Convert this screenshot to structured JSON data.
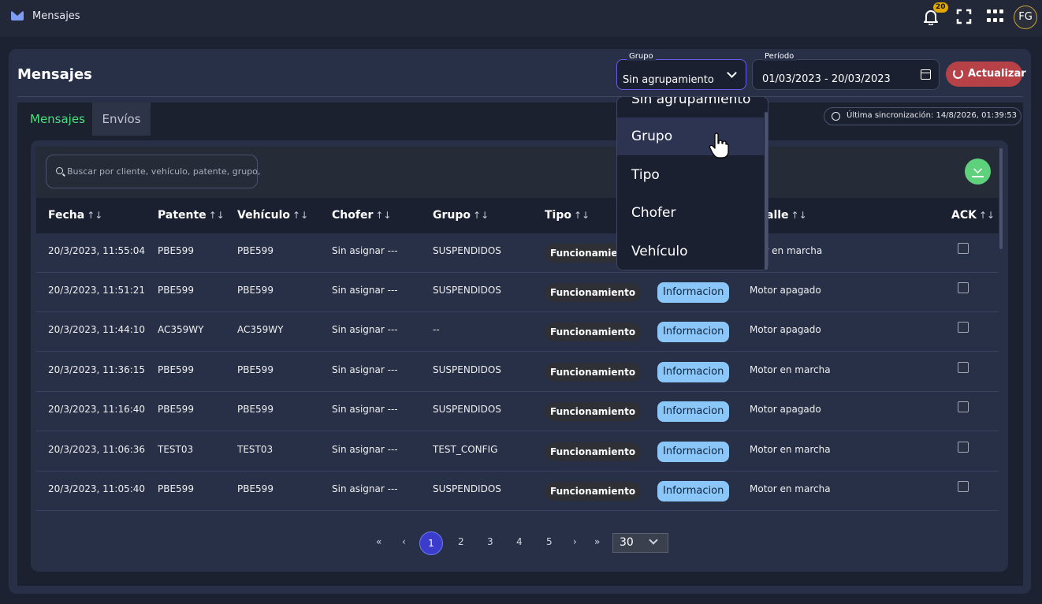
{
  "topbar": {
    "title": "Mensajes",
    "notifications_count": "20",
    "avatar_initials": "FG"
  },
  "page": {
    "title": "Mensajes"
  },
  "filters": {
    "group_label": "Grupo",
    "group_value": "Sin agrupamiento",
    "period_label": "Período",
    "period_value": "01/03/2023 - 20/03/2023",
    "refresh_label": "Actualizar"
  },
  "group_options": [
    "Sin agrupamiento",
    "Grupo",
    "Tipo",
    "Chofer",
    "Vehículo"
  ],
  "tabs": [
    {
      "label": "Mensajes"
    },
    {
      "label": "Envíos"
    }
  ],
  "sync": "Última sincronización: 14/8/2026, 01:39:53",
  "search": {
    "placeholder": "Buscar por cliente, vehículo, patente, grupo,"
  },
  "table": {
    "columns": [
      "Fecha",
      "Patente",
      "Vehículo",
      "Chofer",
      "Grupo",
      "Tipo",
      "alle",
      "ACK"
    ],
    "rows": [
      {
        "fecha": "20/3/2023, 11:55:04",
        "patente": "PBE599",
        "vehiculo": "PBE599",
        "chofer": "Sin asignar ---",
        "grupo": "SUSPENDIDOS",
        "tipo": "Funcionamiento",
        "nivel": "",
        "detalle": "otor en marcha"
      },
      {
        "fecha": "20/3/2023, 11:51:21",
        "patente": "PBE599",
        "vehiculo": "PBE599",
        "chofer": "Sin asignar ---",
        "grupo": "SUSPENDIDOS",
        "tipo": "Funcionamiento",
        "nivel": "Informacion",
        "detalle": "Motor apagado"
      },
      {
        "fecha": "20/3/2023, 11:44:10",
        "patente": "AC359WY",
        "vehiculo": "AC359WY",
        "chofer": "Sin asignar ---",
        "grupo": "--",
        "tipo": "Funcionamiento",
        "nivel": "Informacion",
        "detalle": "Motor apagado"
      },
      {
        "fecha": "20/3/2023, 11:36:15",
        "patente": "PBE599",
        "vehiculo": "PBE599",
        "chofer": "Sin asignar ---",
        "grupo": "SUSPENDIDOS",
        "tipo": "Funcionamiento",
        "nivel": "Informacion",
        "detalle": "Motor en marcha"
      },
      {
        "fecha": "20/3/2023, 11:16:40",
        "patente": "PBE599",
        "vehiculo": "PBE599",
        "chofer": "Sin asignar ---",
        "grupo": "SUSPENDIDOS",
        "tipo": "Funcionamiento",
        "nivel": "Informacion",
        "detalle": "Motor apagado"
      },
      {
        "fecha": "20/3/2023, 11:06:36",
        "patente": "TEST03",
        "vehiculo": "TEST03",
        "chofer": "Sin asignar ---",
        "grupo": "TEST_CONFIG",
        "tipo": "Funcionamiento",
        "nivel": "Informacion",
        "detalle": "Motor en marcha"
      },
      {
        "fecha": "20/3/2023, 11:05:40",
        "patente": "PBE599",
        "vehiculo": "PBE599",
        "chofer": "Sin asignar ---",
        "grupo": "SUSPENDIDOS",
        "tipo": "Funcionamiento",
        "nivel": "Informacion",
        "detalle": "Motor en marcha"
      }
    ]
  },
  "pagination": {
    "pages": [
      "1",
      "2",
      "3",
      "4",
      "5"
    ],
    "current": "1",
    "per_page": "30"
  },
  "colors": {
    "accent": "#6a5ce6",
    "tab_active": "#4ade80",
    "refresh": "#b64248",
    "download": "#5fd17d",
    "badge": "#e0a800",
    "info": "#8bc6f8"
  },
  "icons": [
    "mail-icon",
    "bell-icon",
    "fullscreen-icon",
    "apps-grid-icon",
    "chevron-down-icon",
    "calendar-icon",
    "refresh-icon",
    "clock-icon",
    "search-icon",
    "download-icon",
    "sort-icon",
    "hand-cursor-icon"
  ]
}
